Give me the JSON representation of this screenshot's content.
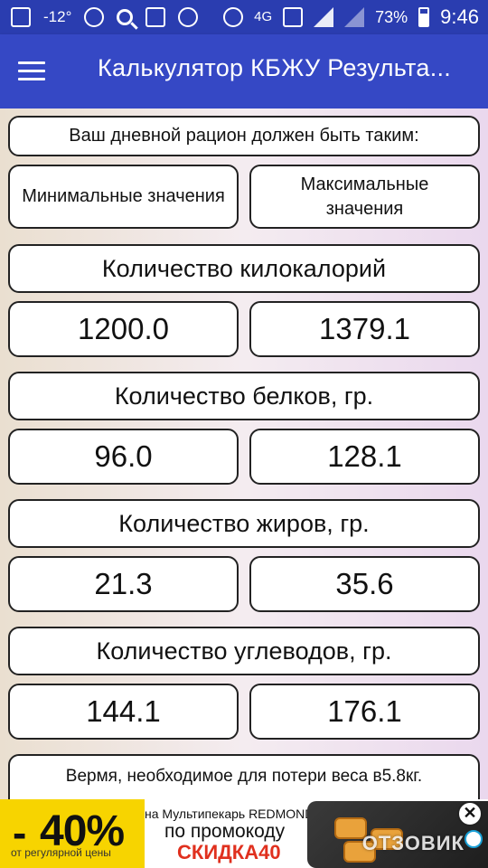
{
  "status_bar": {
    "temperature": "-12°",
    "network": "4G",
    "battery": "73%",
    "time": "9:46"
  },
  "app_bar": {
    "title": "Калькулятор КБЖУ Результа..."
  },
  "content": {
    "header": "Ваш дневной рацион должен быть таким:",
    "min_label": "Минимальные значения",
    "max_label": "Максимальные значения",
    "sections": [
      {
        "label": "Количество килокалорий",
        "min": "1200.0",
        "max": "1379.1"
      },
      {
        "label": "Количество белков, гр.",
        "min": "96.0",
        "max": "128.1"
      },
      {
        "label": "Количество жиров, гр.",
        "min": "21.3",
        "max": "35.6"
      },
      {
        "label": "Количество углеводов, гр.",
        "min": "144.1",
        "max": "176.1"
      }
    ],
    "note": "Вермя, необходимое для потери веса в5.8кг."
  },
  "ad": {
    "discount": "40%",
    "discount_sub": "от регулярной цены",
    "line1": "на Мультипекарь REDMOND",
    "line2": "по промокоду",
    "promo_code": "СКИДКА40",
    "close": "✕",
    "watermark": "ОТЗОВИК"
  },
  "colors": {
    "status_bar": "#2a3db0",
    "app_bar": "#3548c5",
    "ad_yellow": "#f7d400",
    "promo_red": "#e0301e"
  }
}
